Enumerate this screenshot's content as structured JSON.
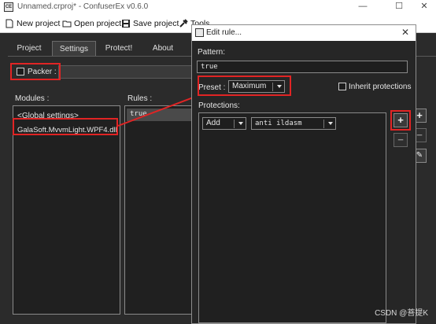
{
  "window": {
    "title": "Unnamed.crproj* - ConfuserEx v0.6.0"
  },
  "toolbar": {
    "new_project": "New project",
    "open_project": "Open project",
    "save_project": "Save project",
    "tools": "Tools"
  },
  "tabs": [
    "Project",
    "Settings",
    "Protect!",
    "About"
  ],
  "settings": {
    "packer_label": "Packer :",
    "modules_label": "Modules :",
    "rules_label": "Rules :",
    "modules": [
      "<Global settings>",
      "GalaSoft.MvvmLight.WPF4.dll"
    ],
    "rules": [
      "true"
    ]
  },
  "dialog": {
    "title": "Edit rule...",
    "pattern_label": "Pattern:",
    "pattern_value": "true",
    "preset_label": "Preset :",
    "preset_value": "Maximum",
    "inherit_label": "Inherit protections",
    "protections_label": "Protections:",
    "action_value": "Add",
    "protection_value": "anti ildasm"
  },
  "watermark": "CSDN @菩提K",
  "colors": {
    "annotation": "#e12424",
    "background": "#2b2b2b"
  }
}
